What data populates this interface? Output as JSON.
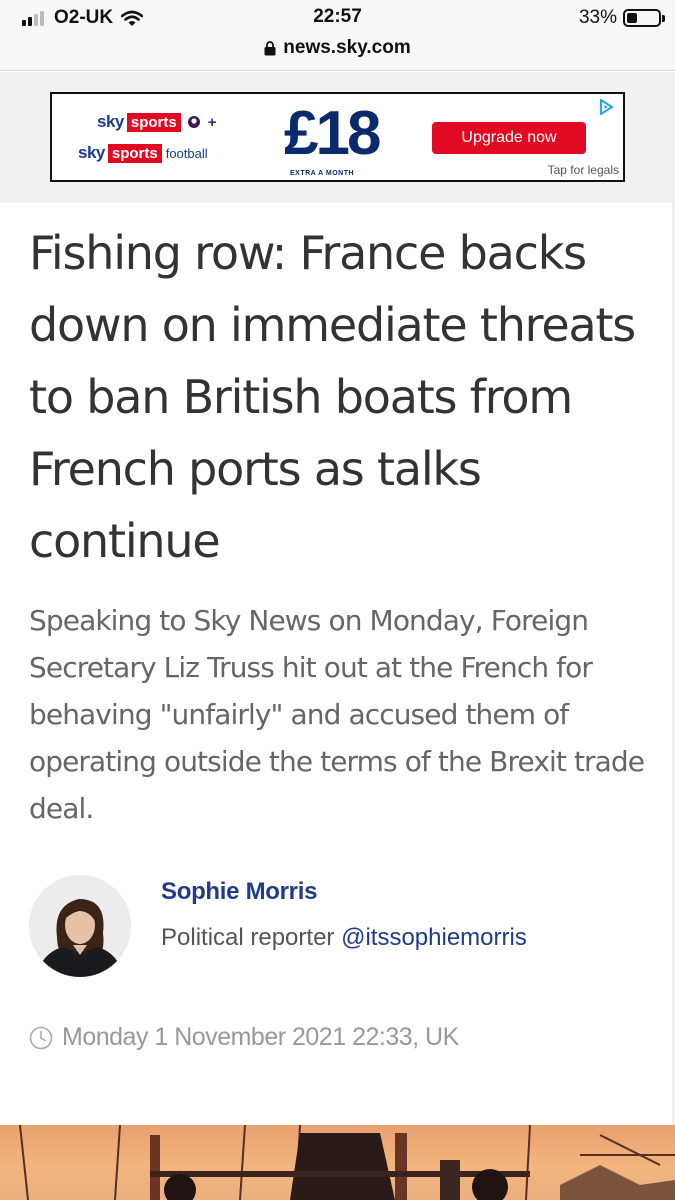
{
  "status_bar": {
    "carrier": "O2-UK",
    "time": "22:57",
    "battery_percent": "33%",
    "battery_level": 0.33,
    "signal_bars_filled": 2
  },
  "browser": {
    "url": "news.sky.com"
  },
  "ad": {
    "brand_line1": "sky",
    "brand_line1_box": "sports",
    "plus": "+",
    "brand_line2": "sky",
    "brand_line2_box": "sports",
    "brand_line2_suffix": "football",
    "price": "£18",
    "price_note": "EXTRA A MONTH",
    "cta": "Upgrade now",
    "legal": "Tap for legals",
    "colors": {
      "red": "#e10a22",
      "navy": "#0b2a6e"
    }
  },
  "article": {
    "headline": "Fishing row: France backs down on immediate threats to ban British boats from French ports as talks continue",
    "standfirst": "Speaking to Sky News on Monday, Foreign Secretary Liz Truss hit out at the French for behaving \"unfairly\" and accused them of operating outside the terms of the Brexit trade deal.",
    "author": {
      "name": "Sophie Morris",
      "role": "Political reporter",
      "handle": "@itssophiemorris"
    },
    "date": "Monday 1 November 2021 22:33, UK"
  }
}
